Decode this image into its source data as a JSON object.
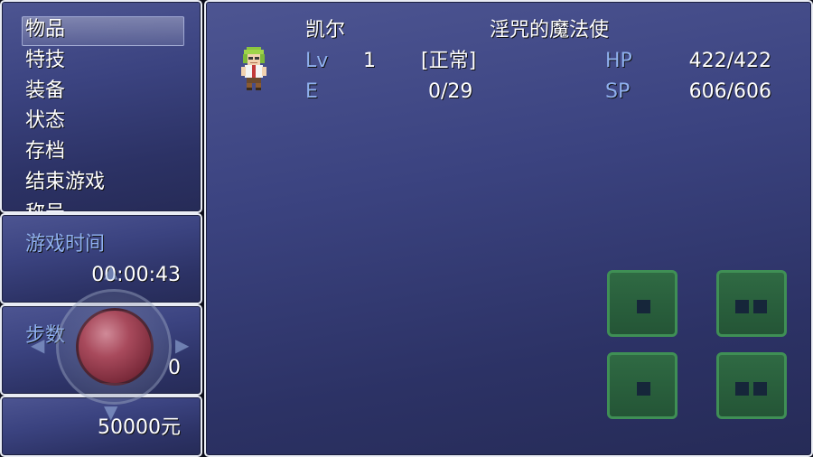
{
  "menu": {
    "items": [
      {
        "label": "物品"
      },
      {
        "label": "特技"
      },
      {
        "label": "装备"
      },
      {
        "label": "状态"
      },
      {
        "label": "存档"
      },
      {
        "label": "结束游戏"
      },
      {
        "label": "称号"
      }
    ],
    "selected_index": 0
  },
  "playtime": {
    "label": "游戏时间",
    "value": "00:00:43"
  },
  "steps": {
    "label": "步数",
    "value": "0"
  },
  "gold": {
    "value": "50000",
    "unit": "元"
  },
  "actor": {
    "name": "凯尔",
    "class": "淫咒的魔法使",
    "level_label": "Lv",
    "level": "1",
    "state": "[正常]",
    "exp_label": "E",
    "exp": "0/29",
    "hp_label": "HP",
    "hp": "422/422",
    "sp_label": "SP",
    "sp": "606/606"
  },
  "colors": {
    "window_bg": "#3b4380",
    "window_border": "#e9ecf4",
    "system_text": "#8fb0ee",
    "button_green": "#2f6a43"
  },
  "icons": {
    "joystick": "virtual-joystick-icon",
    "arrow_left": "arrow-left-icon",
    "arrow_right": "arrow-right-icon",
    "arrow_up": "arrow-up-icon",
    "arrow_down": "arrow-down-icon"
  }
}
